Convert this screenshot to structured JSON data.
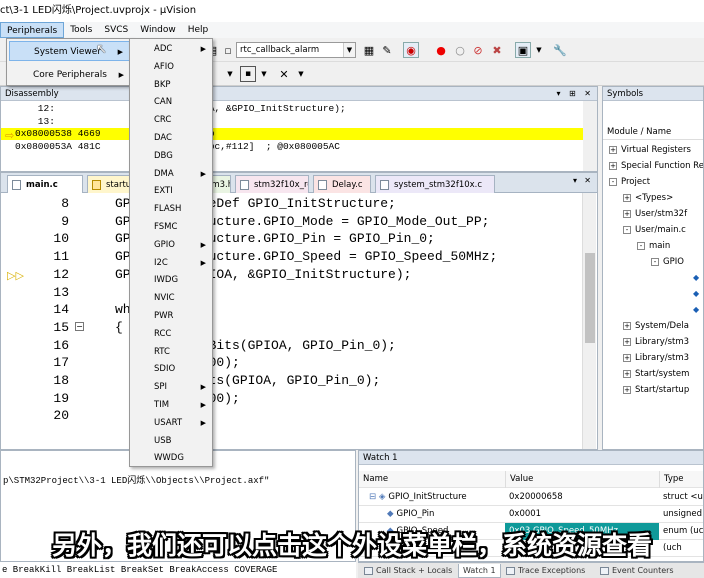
{
  "window": {
    "title": "ct\\3-1 LED闪烁\\Project.uvprojx - µVision"
  },
  "menubar": [
    "Peripherals",
    "Tools",
    "SVCS",
    "Window",
    "Help"
  ],
  "toolbar": {
    "function_combo": "rtc_callback_alarm"
  },
  "peripherals_menu": [
    {
      "label": "System Viewer",
      "selected": true
    },
    {
      "label": "Core Peripherals",
      "selected": false
    }
  ],
  "system_viewer_menu": [
    {
      "label": "ADC",
      "sub": true
    },
    {
      "label": "AFIO",
      "sub": false
    },
    {
      "label": "BKP",
      "sub": false
    },
    {
      "label": "CAN",
      "sub": false
    },
    {
      "label": "CRC",
      "sub": false
    },
    {
      "label": "DAC",
      "sub": false
    },
    {
      "label": "DBG",
      "sub": false
    },
    {
      "label": "DMA",
      "sub": true
    },
    {
      "label": "EXTI",
      "sub": false
    },
    {
      "label": "FLASH",
      "sub": false
    },
    {
      "label": "FSMC",
      "sub": false
    },
    {
      "label": "GPIO",
      "sub": true
    },
    {
      "label": "I2C",
      "sub": true
    },
    {
      "label": "IWDG",
      "sub": false
    },
    {
      "label": "NVIC",
      "sub": false
    },
    {
      "label": "PWR",
      "sub": false
    },
    {
      "label": "RCC",
      "sub": false
    },
    {
      "label": "RTC",
      "sub": false
    },
    {
      "label": "SDIO",
      "sub": false
    },
    {
      "label": "SPI",
      "sub": true
    },
    {
      "label": "TIM",
      "sub": true
    },
    {
      "label": "USART",
      "sub": true
    },
    {
      "label": "USB",
      "sub": false
    },
    {
      "label": "WWDG",
      "sub": false
    }
  ],
  "disassembly": {
    "title": "Disassembly",
    "lines": [
      {
        "text": "    12:             GPIO_Init(GPIOA, &GPIO_InitStructure);",
        "highlight": false
      },
      {
        "text": "    13:",
        "highlight": false
      },
      {
        "text": "0x08000538 4669      MOV      r1,sp",
        "highlight": true
      },
      {
        "text": "0x0800053A 481C      LDR      r0,[pc,#112]  ; @0x080005AC",
        "highlight": false
      }
    ]
  },
  "editor": {
    "tabs": [
      "main.c",
      "startup_stm32f10x_md.s",
      "core_cm3.h",
      "stm32f10x_rcc.c",
      "Delay.c",
      "system_stm32f10x.c"
    ],
    "lines": [
      {
        "num": "8",
        "pre": "GPIO_InitTypeDef GPIO_InitStructure;"
      },
      {
        "num": "9",
        "pre": "GPIO_InitStructure.GPIO_Mode = GPIO_Mode_Out_PP;"
      },
      {
        "num": "10",
        "pre": "GPIO_InitStructure.GPIO_Pin = GPIO_Pin_0;"
      },
      {
        "num": "11",
        "pre": "GPIO_InitStructure.GPIO_Speed = GPIO_Speed_50MHz;"
      },
      {
        "num": "12",
        "pre": "GPIO_Init(GPIOA, &GPIO_InitStructure);"
      },
      {
        "num": "13",
        "pre": ""
      },
      {
        "num": "14",
        "pre": "while (1)"
      },
      {
        "num": "15",
        "pre": "{"
      },
      {
        "num": "16",
        "pre": "  GPIO_ResetBits(GPIOA, GPIO_Pin_0);"
      },
      {
        "num": "17",
        "pre": "  Delay_ms(500);"
      },
      {
        "num": "18",
        "pre": "  GPIO_SetBits(GPIOA, GPIO_Pin_0);"
      },
      {
        "num": "19",
        "pre": "  Delay_ms(500);"
      },
      {
        "num": "20",
        "pre": ""
      }
    ]
  },
  "symbols": {
    "title": "Symbols",
    "header": "Module / Name",
    "items": [
      {
        "label": "Virtual Registers",
        "exp": "+"
      },
      {
        "label": "Special Function Re",
        "exp": "+"
      },
      {
        "label": "Project",
        "exp": "-"
      },
      {
        "label": "<Types>",
        "exp": "+"
      },
      {
        "label": "User/stm32f",
        "exp": "+"
      },
      {
        "label": "User/main.c",
        "exp": "-"
      },
      {
        "label": "main",
        "exp": "-"
      },
      {
        "label": "GPIO",
        "exp": "-"
      },
      {
        "label": "System/Dela",
        "exp": "+"
      },
      {
        "label": "Library/stm3",
        "exp": "+"
      },
      {
        "label": "Library/stm3",
        "exp": "+"
      },
      {
        "label": "Start/system",
        "exp": "+"
      },
      {
        "label": "Start/startup",
        "exp": "+"
      }
    ]
  },
  "build_output": {
    "path": "p\\STM32Project\\\\3-1 LED闪烁\\\\Objects\\\\Project.axf\""
  },
  "watch": {
    "title": "Watch 1",
    "columns": [
      "Name",
      "Value",
      "Type"
    ],
    "rows": [
      {
        "name": "GPIO_InitStructure",
        "value": "0x20000658",
        "type": "struct <un",
        "selected": false
      },
      {
        "name": "GPIO_Pin",
        "value": "0x0001",
        "type": "unsigned s",
        "selected": false
      },
      {
        "name": "GPIO_Speed",
        "value": "0x03 GPIO_Speed_50MHz",
        "type": "enum (uch",
        "selected": true
      },
      {
        "name": "",
        "value": "0x1",
        "type": "(uch",
        "selected": false
      }
    ]
  },
  "command_line": "e BreakKill BreakList BreakSet BreakAccess COVERAGE",
  "bottom_tabs": [
    "Call Stack + Locals",
    "Watch 1",
    "Trace Exceptions",
    "Event Counters"
  ],
  "subtitle": "另外，我们还可以点击这个外设菜单栏，系统资源查看"
}
